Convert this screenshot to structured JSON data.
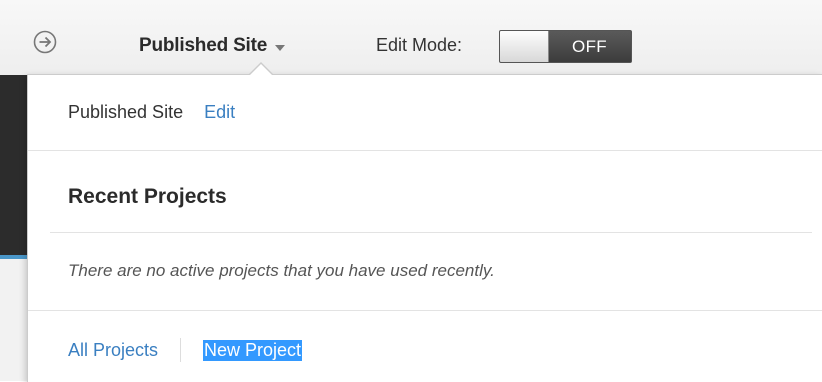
{
  "topbar": {
    "nav_icon": "circle-arrow-right-icon",
    "site_selector": {
      "label": "Published Site",
      "icon": "chevron-down-icon"
    },
    "edit_mode": {
      "label": "Edit Mode:",
      "state": "OFF"
    }
  },
  "dropdown": {
    "published_site": {
      "label": "Published Site",
      "edit_link": "Edit"
    },
    "recent_projects": {
      "title": "Recent Projects",
      "empty_message": "There are no active projects that you have used recently."
    },
    "footer": {
      "all_projects": "All Projects",
      "new_project": "New Project"
    }
  },
  "colors": {
    "link": "#3a7fc1",
    "selection": "#3399ff",
    "toggle_dark": "#3c3c3c",
    "accent_blue": "#4a97c9"
  }
}
